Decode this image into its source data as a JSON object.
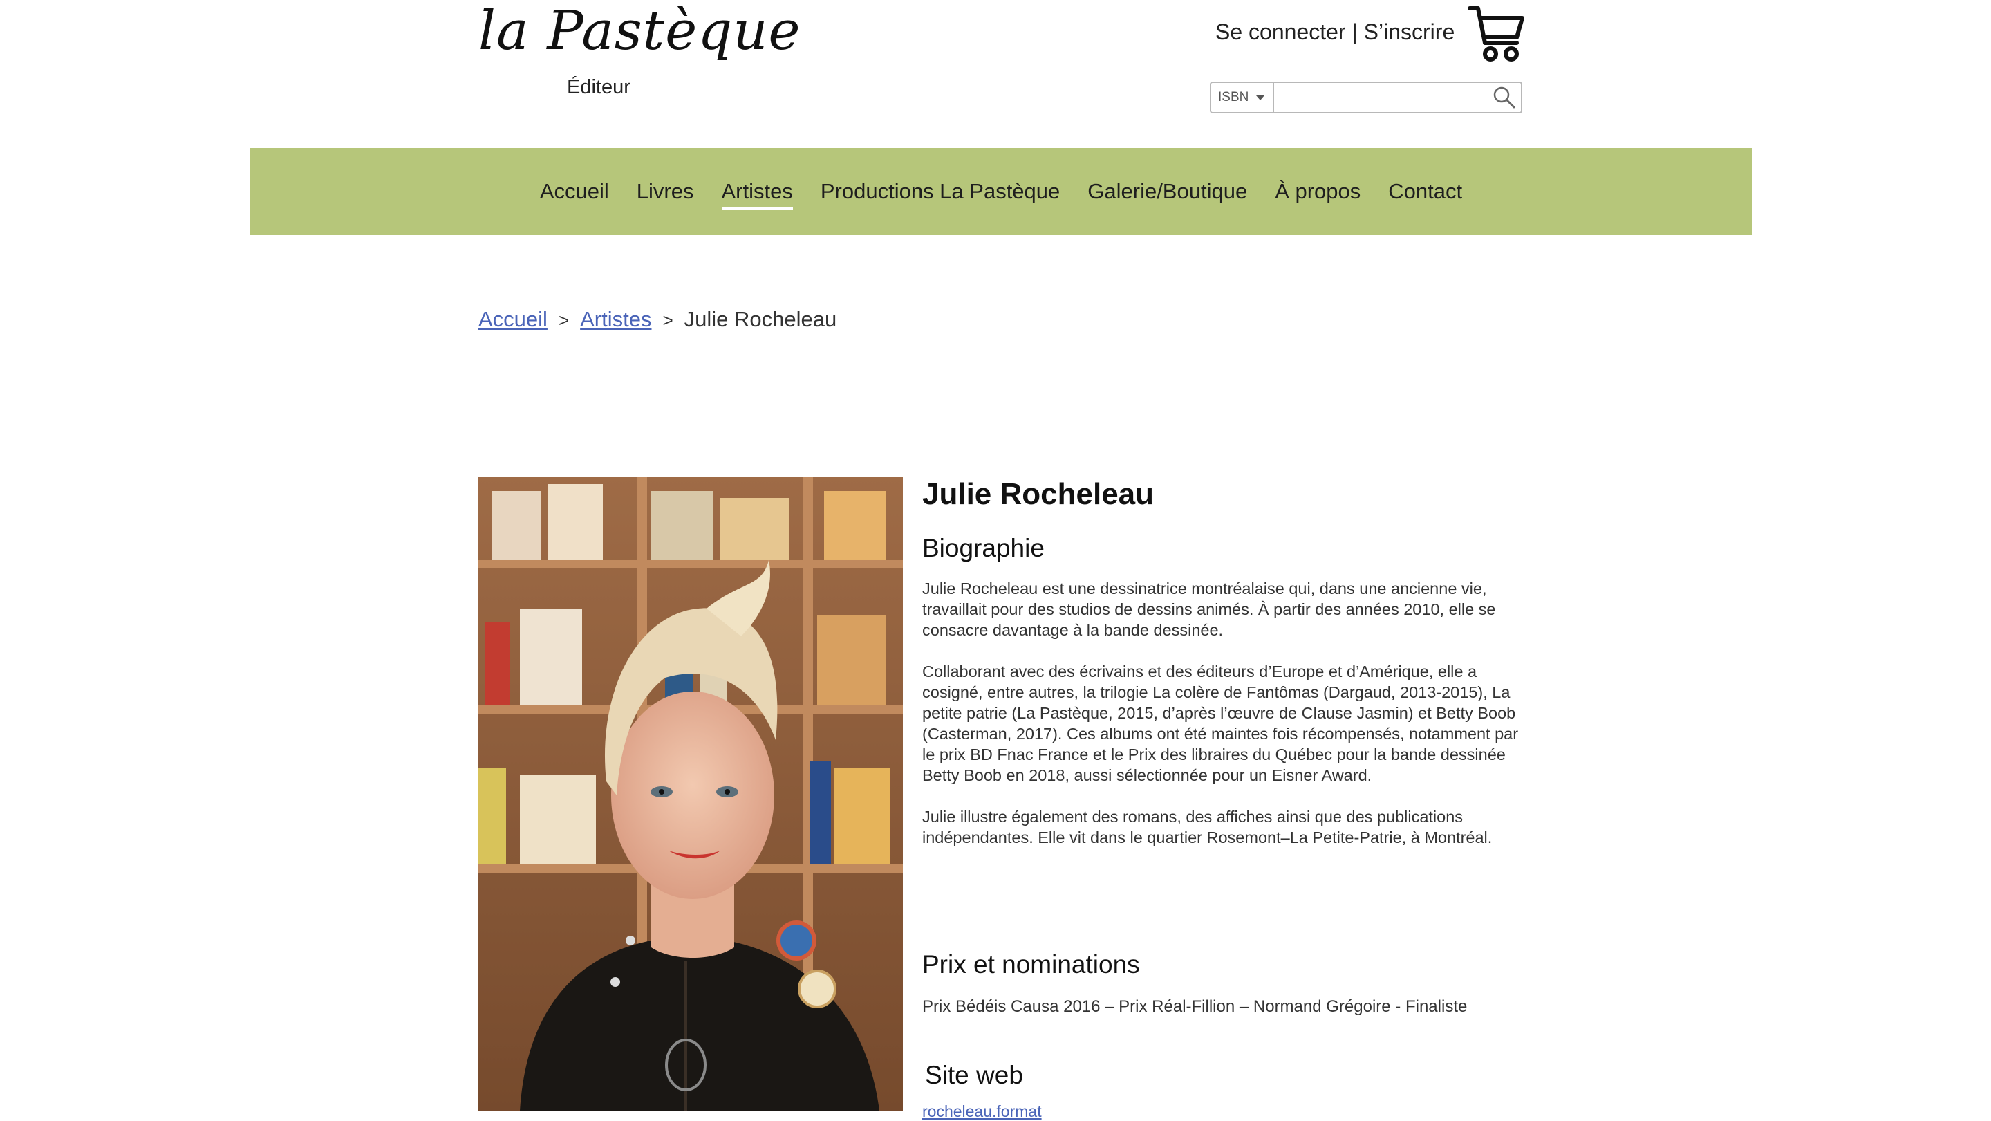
{
  "header": {
    "logo_script": "la Pastèque",
    "logo_subtitle": "Éditeur",
    "login_label": "Se connecter",
    "separator": " | ",
    "signup_label": "S’inscrire",
    "search": {
      "type_selected": "ISBN",
      "value": "",
      "icon": "search-icon"
    },
    "cart_icon": "cart-icon"
  },
  "nav": {
    "accent_color": "#b6c67a",
    "items": [
      {
        "label": "Accueil"
      },
      {
        "label": "Livres"
      },
      {
        "label": "Artistes"
      },
      {
        "label": "Productions La Pastèque"
      },
      {
        "label": "Galerie/Boutique"
      },
      {
        "label": "À propos"
      },
      {
        "label": "Contact"
      }
    ],
    "active_index": 2
  },
  "breadcrumb": {
    "home": "Accueil",
    "artists": "Artistes",
    "current": "Julie Rocheleau",
    "sep": ">"
  },
  "artist": {
    "name": "Julie Rocheleau",
    "bio_heading": "Biographie",
    "bio_paragraphs": [
      "Julie Rocheleau est une dessinatrice montréalaise qui, dans une ancienne vie, travaillait pour des studios de dessins animés. À partir des années 2010, elle se consacre davantage à la bande dessinée.",
      "Collaborant avec des écrivains et des éditeurs d’Europe et d’Amérique, elle a cosigné, entre autres, la trilogie La colère de Fantômas (Dargaud, 2013-2015), La petite patrie (La Pastèque, 2015, d’après l’œuvre de Clause Jasmin) et Betty Boob (Casterman, 2017). Ces albums ont été maintes fois récompensés, notamment par le prix BD Fnac France et le Prix des libraires du Québec pour la bande dessinée Betty Boob en 2018, aussi sélectionnée pour un Eisner Award.",
      "Julie illustre également des romans, des affiches ainsi que des publications indépendantes. Elle vit dans le quartier Rosemont–La Petite-Patrie, à Montréal."
    ],
    "awards_heading": "Prix et nominations",
    "awards_text": "Prix Bédéis Causa 2016 – Prix Réal-Fillion – Normand Grégoire - Finaliste",
    "website_heading": "Site web",
    "website_link": "rocheleau.format"
  }
}
